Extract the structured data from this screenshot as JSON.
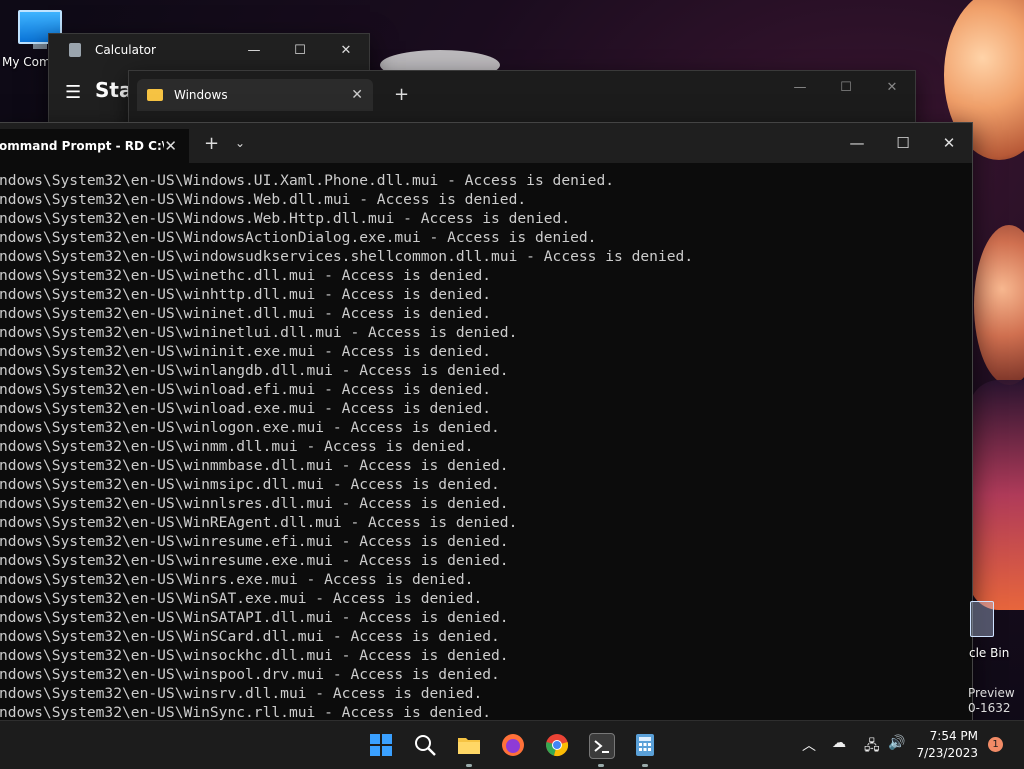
{
  "desktop": {
    "icons": [
      {
        "label": "My Com"
      }
    ],
    "recycle_bin_label": "cle Bin",
    "watermark_line1": "Preview",
    "watermark_line2": "0-1632"
  },
  "calculator": {
    "title": "Calculator",
    "mode": "Star"
  },
  "explorer": {
    "tab_label": "Windows",
    "close_glyph": "✕",
    "new_tab_glyph": "+"
  },
  "terminal": {
    "tab_label": "ommand Prompt - RD  C:\\ /S",
    "close_glyph": "✕",
    "new_tab_glyph": "+",
    "dropdown_glyph": "⌄",
    "lines": [
      "ndows\\System32\\en-US\\Windows.UI.Xaml.Phone.dll.mui - Access is denied.",
      "ndows\\System32\\en-US\\Windows.Web.dll.mui - Access is denied.",
      "ndows\\System32\\en-US\\Windows.Web.Http.dll.mui - Access is denied.",
      "ndows\\System32\\en-US\\WindowsActionDialog.exe.mui - Access is denied.",
      "ndows\\System32\\en-US\\windowsudkservices.shellcommon.dll.mui - Access is denied.",
      "ndows\\System32\\en-US\\winethc.dll.mui - Access is denied.",
      "ndows\\System32\\en-US\\winhttp.dll.mui - Access is denied.",
      "ndows\\System32\\en-US\\wininet.dll.mui - Access is denied.",
      "ndows\\System32\\en-US\\wininetlui.dll.mui - Access is denied.",
      "ndows\\System32\\en-US\\wininit.exe.mui - Access is denied.",
      "ndows\\System32\\en-US\\winlangdb.dll.mui - Access is denied.",
      "ndows\\System32\\en-US\\winload.efi.mui - Access is denied.",
      "ndows\\System32\\en-US\\winload.exe.mui - Access is denied.",
      "ndows\\System32\\en-US\\winlogon.exe.mui - Access is denied.",
      "ndows\\System32\\en-US\\winmm.dll.mui - Access is denied.",
      "ndows\\System32\\en-US\\winmmbase.dll.mui - Access is denied.",
      "ndows\\System32\\en-US\\winmsipc.dll.mui - Access is denied.",
      "ndows\\System32\\en-US\\winnlsres.dll.mui - Access is denied.",
      "ndows\\System32\\en-US\\WinREAgent.dll.mui - Access is denied.",
      "ndows\\System32\\en-US\\winresume.efi.mui - Access is denied.",
      "ndows\\System32\\en-US\\winresume.exe.mui - Access is denied.",
      "ndows\\System32\\en-US\\Winrs.exe.mui - Access is denied.",
      "ndows\\System32\\en-US\\WinSAT.exe.mui - Access is denied.",
      "ndows\\System32\\en-US\\WinSATAPI.dll.mui - Access is denied.",
      "ndows\\System32\\en-US\\WinSCard.dll.mui - Access is denied.",
      "ndows\\System32\\en-US\\winsockhc.dll.mui - Access is denied.",
      "ndows\\System32\\en-US\\winspool.drv.mui - Access is denied.",
      "ndows\\System32\\en-US\\winsrv.dll.mui - Access is denied.",
      "ndows\\System32\\en-US\\WinSync.rll.mui - Access is denied."
    ]
  },
  "window_controls": {
    "minimize": "—",
    "maximize": "☐",
    "close": "✕"
  },
  "taskbar": {
    "apps": [
      {
        "name": "start",
        "icon": "windows-logo-icon",
        "color": "#3aa0ff"
      },
      {
        "name": "search",
        "icon": "search-icon",
        "color": "#ffffff"
      },
      {
        "name": "file-explorer",
        "icon": "folder-icon",
        "color": "#f6c343"
      },
      {
        "name": "firefox",
        "icon": "firefox-icon",
        "color": "#ff7139"
      },
      {
        "name": "chrome",
        "icon": "chrome-icon",
        "color": "#34a853"
      },
      {
        "name": "terminal",
        "icon": "terminal-icon",
        "color": "#3b3b3b"
      },
      {
        "name": "calculator",
        "icon": "calculator-icon",
        "color": "#5aa0d8"
      }
    ],
    "time": "7:54 PM",
    "date": "7/23/2023",
    "notification_count": "1"
  },
  "colors": {
    "accent": "#0a74d8",
    "console_text": "#cccccc",
    "badge": "#f28b66"
  }
}
